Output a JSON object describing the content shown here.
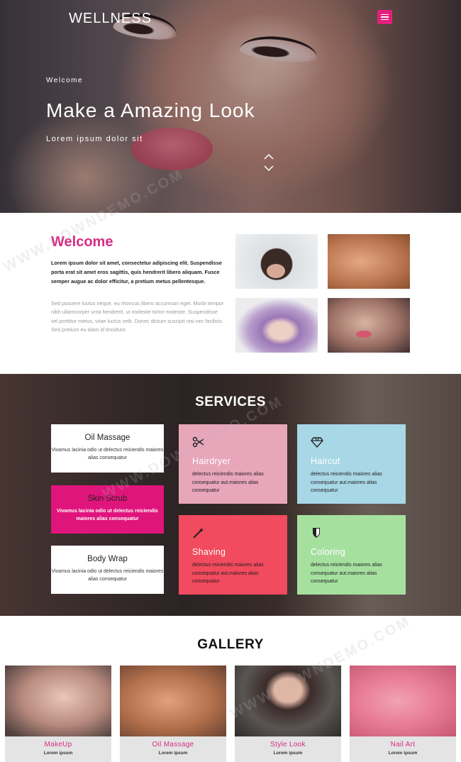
{
  "header": {
    "brand": "WELLNESS",
    "menu_icon": "hamburger-menu-icon"
  },
  "hero": {
    "welcome": "Welcome",
    "title": "Make a Amazing Look",
    "subtitle": "Lorem ipsum dolor sit"
  },
  "welcome": {
    "title": "Welcome",
    "bold_text": "Lorem ipsum dolor sit amet, consectetur adipiscing elit. Suspendisse porta erat sit amet eros sagittis, quis hendrerit libero aliquam. Fusce semper augue ac dolor efficitur, a pretium metus pellentesque.",
    "light_text": "Sed posuere luctus neque, eu rhoncus libero accumsan eget. Morbi tempor nibh ullamcorper urna hendrerit, ut molestie tortor molestie. Suspendisse vel porttitor metus, vitae luctus velit. Donec dictum suscipit nisi nec facilisis. Sed pretium eu diam id tincidunt."
  },
  "services": {
    "title": "SERVICES",
    "small": [
      {
        "title": "Oil Massage",
        "desc": "Vivamus lacinia odio ut delectus reiciendis maiores alias consequatur"
      },
      {
        "title": "Skin Scrub",
        "desc": "Vivamus lacinia odio ut delectus reiciendis maiores alias consequatur"
      },
      {
        "title": "Body Wrap",
        "desc": "Vivamus lacinia odio ut delectus reiciendis maiores alias consequatur"
      }
    ],
    "big": [
      {
        "title": "Hairdryer",
        "icon": "scissors-icon",
        "color": "#e8a6bb",
        "desc": "delectus reiciendis maiores alias consequatur aut.maiores alias consequatur"
      },
      {
        "title": "Haircut",
        "icon": "diamond-icon",
        "color": "#a8d7e6",
        "desc": "delectus reiciendis maiores alias consequatur aut.maiores alias consequatur"
      },
      {
        "title": "Shaving",
        "icon": "magic-wand-icon",
        "color": "#f24a5e",
        "desc": "delectus reiciendis maiores alias consequatur aut.maiores alias consequatur"
      },
      {
        "title": "Coloring",
        "icon": "shield-icon",
        "color": "#a6e09f",
        "desc": "delectus reiciendis maiores alias consequatur aut.maiores alias consequatur"
      }
    ]
  },
  "gallery": {
    "title": "GALLERY",
    "items": [
      {
        "title": "MakeUp",
        "desc": "Lorem ipsum"
      },
      {
        "title": "Oil Massage",
        "desc": "Lorem ipsum"
      },
      {
        "title": "Style Look",
        "desc": "Lorem ipsum"
      },
      {
        "title": "Nail Art",
        "desc": "Lorem ipsum"
      }
    ]
  },
  "watermark": "WWW.DOWNDEMO.COM"
}
